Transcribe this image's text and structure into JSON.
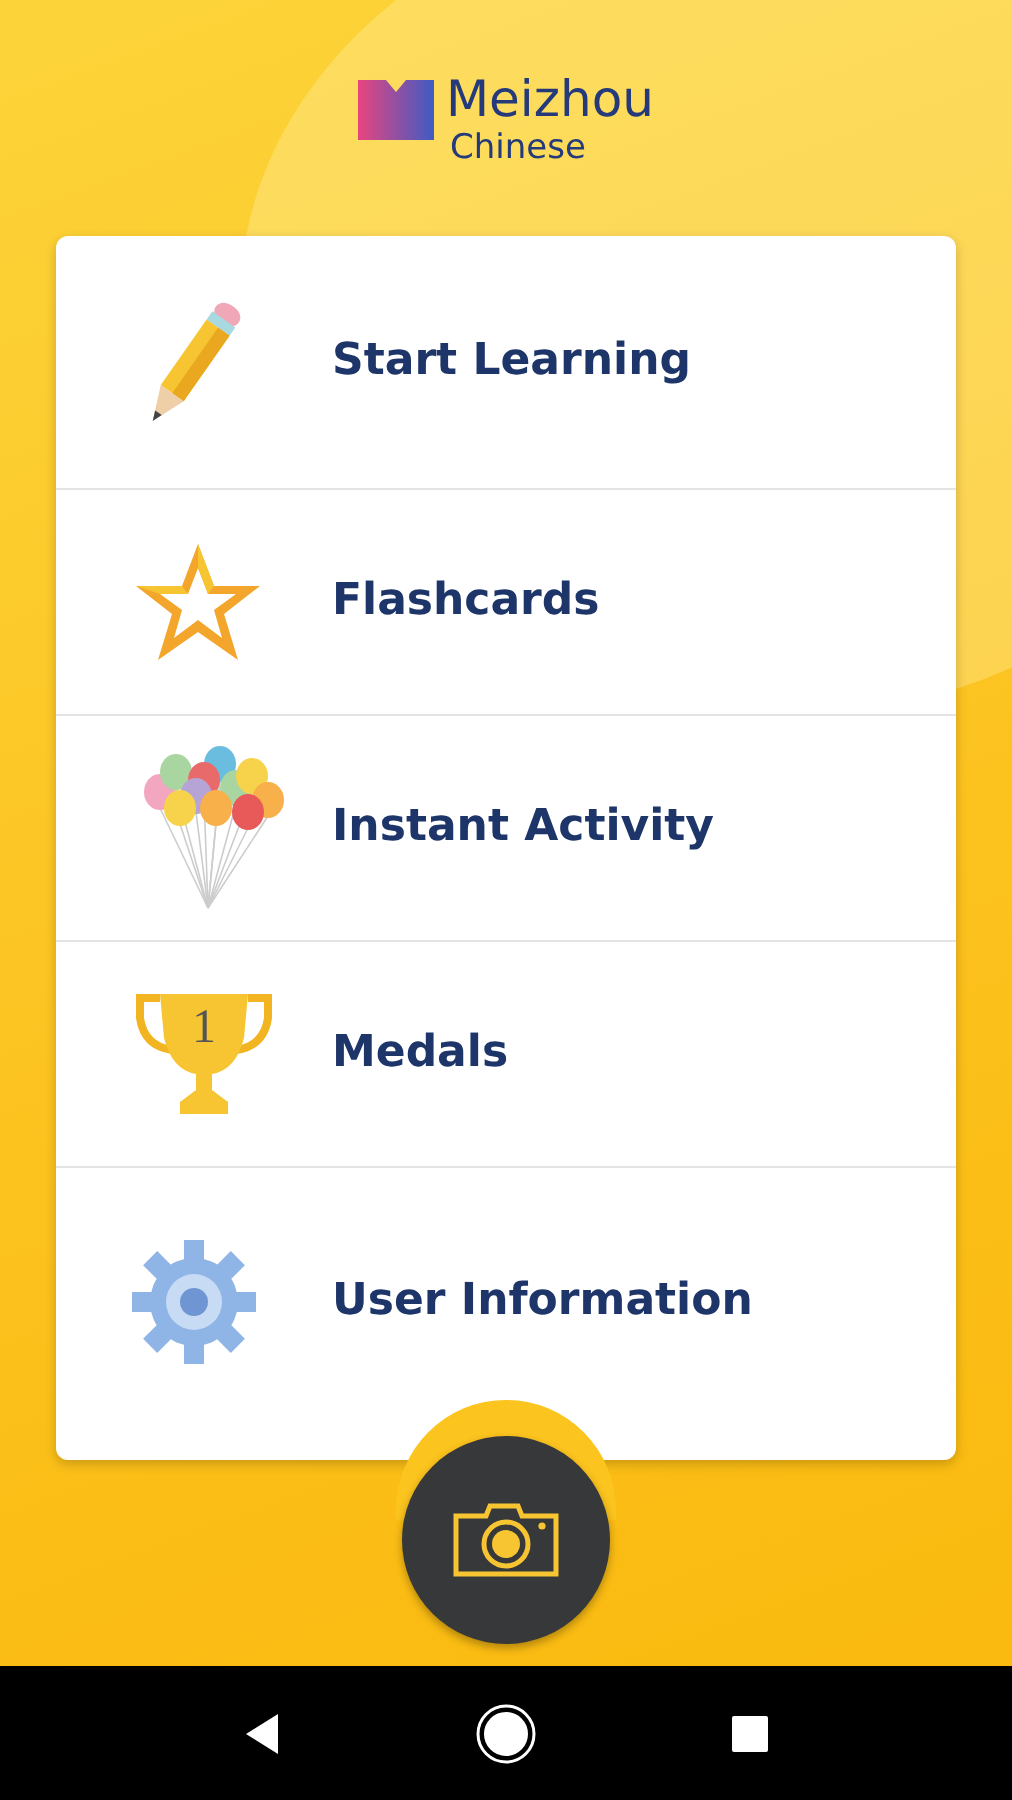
{
  "logo": {
    "title": "Meizhou",
    "subtitle": "Chinese"
  },
  "menu": [
    {
      "kind": "pencil",
      "label": "Start Learning"
    },
    {
      "kind": "star",
      "label": "Flashcards"
    },
    {
      "kind": "balloons",
      "label": "Instant Activity"
    },
    {
      "kind": "trophy",
      "label": "Medals",
      "icon_text": "1"
    },
    {
      "kind": "gear",
      "label": "User Information"
    }
  ]
}
